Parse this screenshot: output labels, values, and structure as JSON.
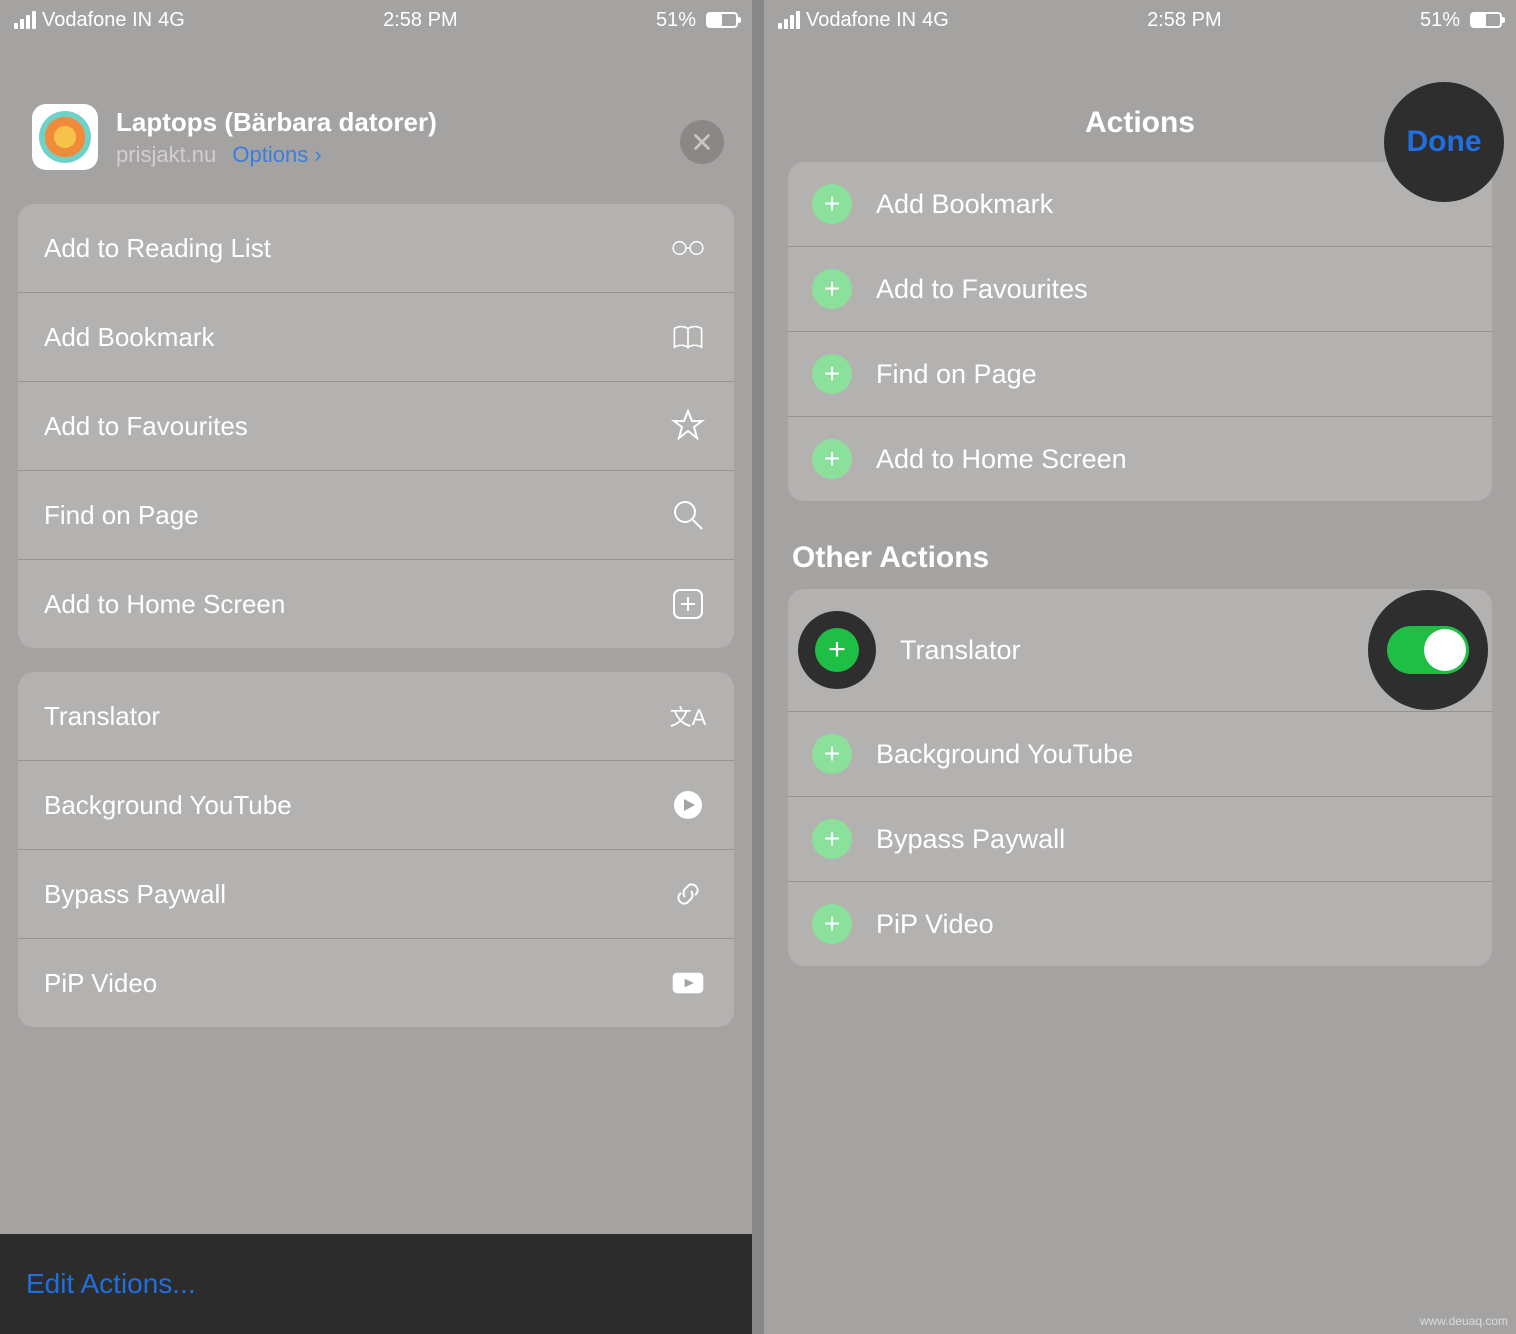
{
  "status": {
    "carrier": "Vodafone IN",
    "network": "4G",
    "time": "2:58 PM",
    "battery": "51%"
  },
  "left": {
    "share_title": "Laptops (Bärbara datorer)",
    "share_domain": "prisjakt.nu",
    "share_options": "Options",
    "rows_group1": [
      "Add to Reading List",
      "Add Bookmark",
      "Add to Favourites",
      "Find on Page",
      "Add to Home Screen"
    ],
    "rows_group2": [
      "Translator",
      "Background YouTube",
      "Bypass Paywall",
      "PiP Video"
    ],
    "edit_actions": "Edit Actions..."
  },
  "right": {
    "title": "Actions",
    "done": "Done",
    "top_actions": [
      "Add Bookmark",
      "Add to Favourites",
      "Find on Page",
      "Add to Home Screen"
    ],
    "section_header": "Other Actions",
    "other_actions": [
      "Translator",
      "Background YouTube",
      "Bypass Paywall",
      "PiP Video"
    ]
  },
  "watermark": "www.deuaq.com"
}
